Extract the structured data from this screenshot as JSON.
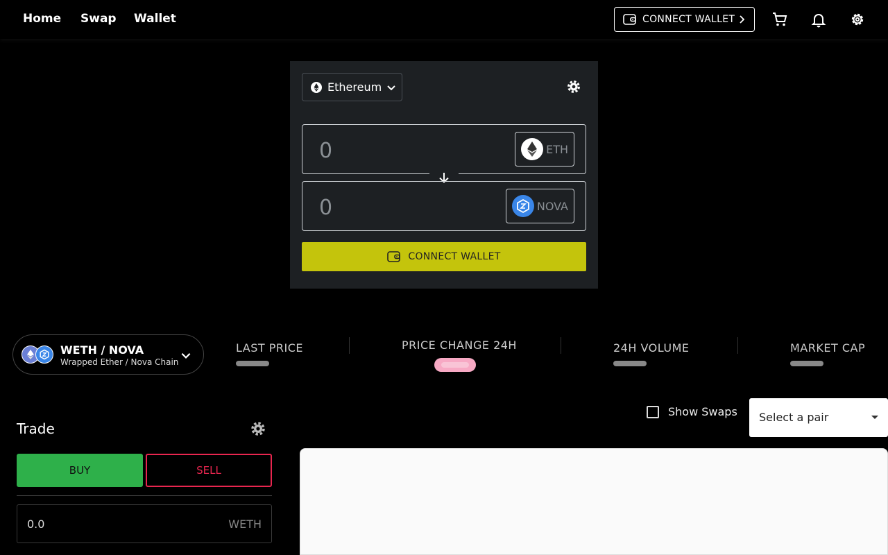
{
  "nav": {
    "links": [
      "Home",
      "Swap",
      "Wallet"
    ],
    "connect_label": "CONNECT WALLET"
  },
  "icons": {
    "cart": "cart-icon",
    "bell": "bell-icon",
    "settings": "gear-icon",
    "wallet": "wallet-icon"
  },
  "swap": {
    "network": "Ethereum",
    "from": {
      "amount": "0",
      "token": "ETH"
    },
    "to": {
      "amount": "0",
      "token": "NOVA"
    },
    "connect_label": "CONNECT WALLET"
  },
  "market": {
    "pair": "WETH / NOVA",
    "pair_sub": "Wrapped Ether / Nova Chain",
    "stats": [
      "LAST PRICE",
      "PRICE CHANGE 24H",
      "24H VOLUME",
      "MARKET CAP"
    ]
  },
  "trade": {
    "title": "Trade",
    "buy_label": "BUY",
    "sell_label": "SELL",
    "amount": "0.0",
    "unit": "WETH"
  },
  "chart": {
    "show_swaps_label": "Show Swaps",
    "pair_select_placeholder": "Select a pair"
  },
  "colors": {
    "accent": "#c4c40c",
    "buy": "#2eb04a",
    "sell": "#e8264f",
    "card": "#1d2023",
    "price_change_bar": "#f7a9c4"
  }
}
